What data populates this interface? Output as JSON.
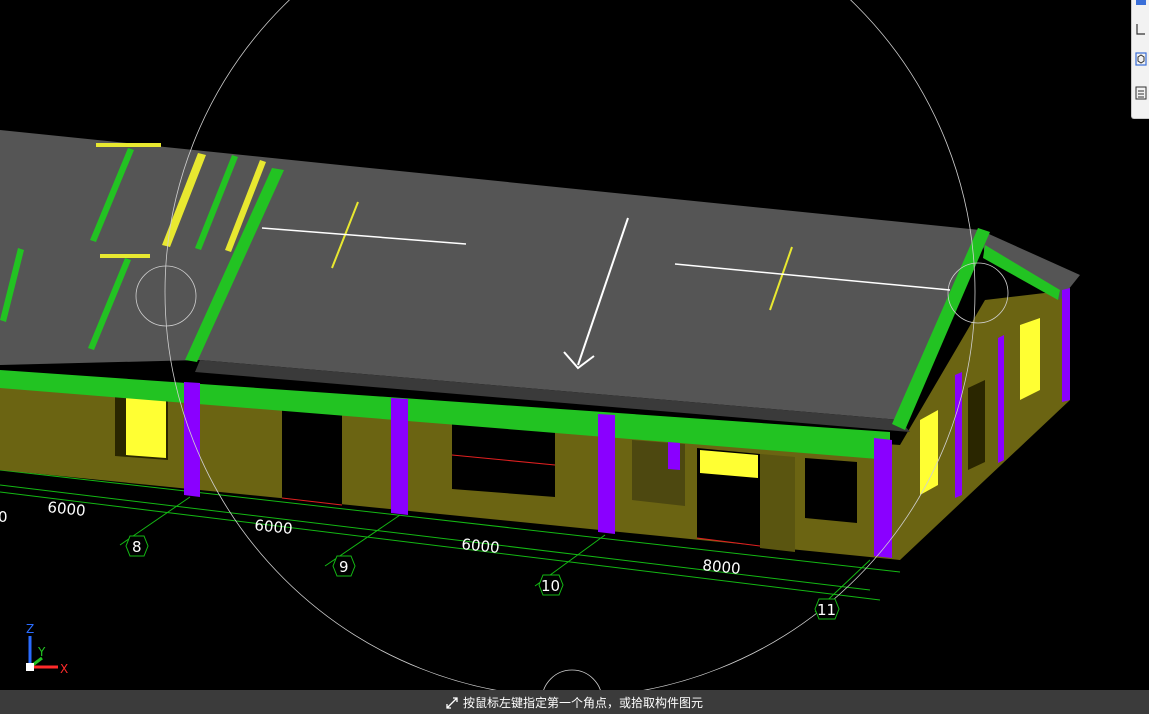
{
  "viewport": {
    "dimensions": [
      "6000",
      "6000",
      "6000",
      "8000"
    ],
    "dimension_partial": "0",
    "axes": [
      "8",
      "9",
      "10",
      "11"
    ],
    "colors": {
      "roof": "#555555",
      "wall": "#6b6412",
      "beam": "#22c322",
      "column": "#8a00ff",
      "window": "#ffff33",
      "grid": "#14b814",
      "outline": "#cfcfcf"
    }
  },
  "triad": {
    "x": "X",
    "y": "Y",
    "z": "Z"
  },
  "toolbar": {
    "buttons": [
      "select-icon",
      "window-select-icon",
      "3d-view-icon",
      "properties-icon"
    ]
  },
  "status": {
    "icon": "cursor-arrow-icon",
    "message": "按鼠标左键指定第一个角点，或拾取构件图元"
  }
}
